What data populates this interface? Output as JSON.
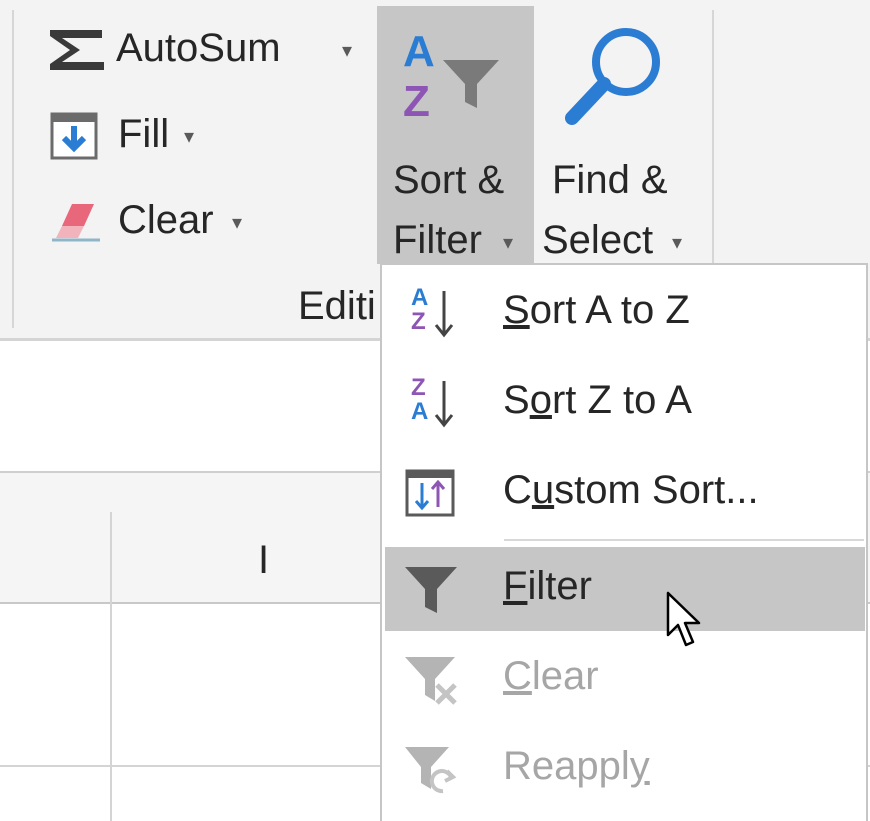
{
  "ribbon": {
    "editing_group_label": "Editi",
    "autosum_label": "AutoSum",
    "fill_label": "Fill",
    "clear_label": "Clear",
    "sort_filter": {
      "line1": "Sort &",
      "line2": "Filter"
    },
    "find_select": {
      "line1": "Find &",
      "line2": "Select"
    },
    "icons": {
      "sort_a": "A",
      "sort_z": "Z"
    }
  },
  "sheet": {
    "column_header": "I"
  },
  "menu": {
    "items": [
      {
        "label": "Sort A to Z",
        "accesskey": "S",
        "icon": "sort-a-to-z-icon",
        "enabled": true,
        "glyph_top": "A",
        "glyph_bottom": "Z"
      },
      {
        "label": "Sort Z to A",
        "accesskey": "o",
        "icon": "sort-z-to-a-icon",
        "enabled": true,
        "glyph_top": "Z",
        "glyph_bottom": "A"
      },
      {
        "label": "Custom Sort...",
        "accesskey": "u",
        "icon": "custom-sort-icon",
        "enabled": true
      },
      {
        "label": "Filter",
        "accesskey": "F",
        "icon": "filter-icon",
        "enabled": true,
        "highlighted": true
      },
      {
        "label": "Clear",
        "accesskey": "C",
        "icon": "clear-filter-icon",
        "enabled": false
      },
      {
        "label": "Reapply",
        "accesskey": "y",
        "icon": "reapply-filter-icon",
        "enabled": false
      }
    ]
  },
  "colors": {
    "ribbon_bg": "#f3f3f3",
    "pressed_bg": "#c6c6c6",
    "highlight_bg": "#c6c6c6",
    "text": "#262626",
    "disabled_text": "#a6a6a6",
    "accent_blue": "#2b7cd3",
    "accent_purple": "#8e56b4",
    "eraser_pink": "#e8677a"
  }
}
